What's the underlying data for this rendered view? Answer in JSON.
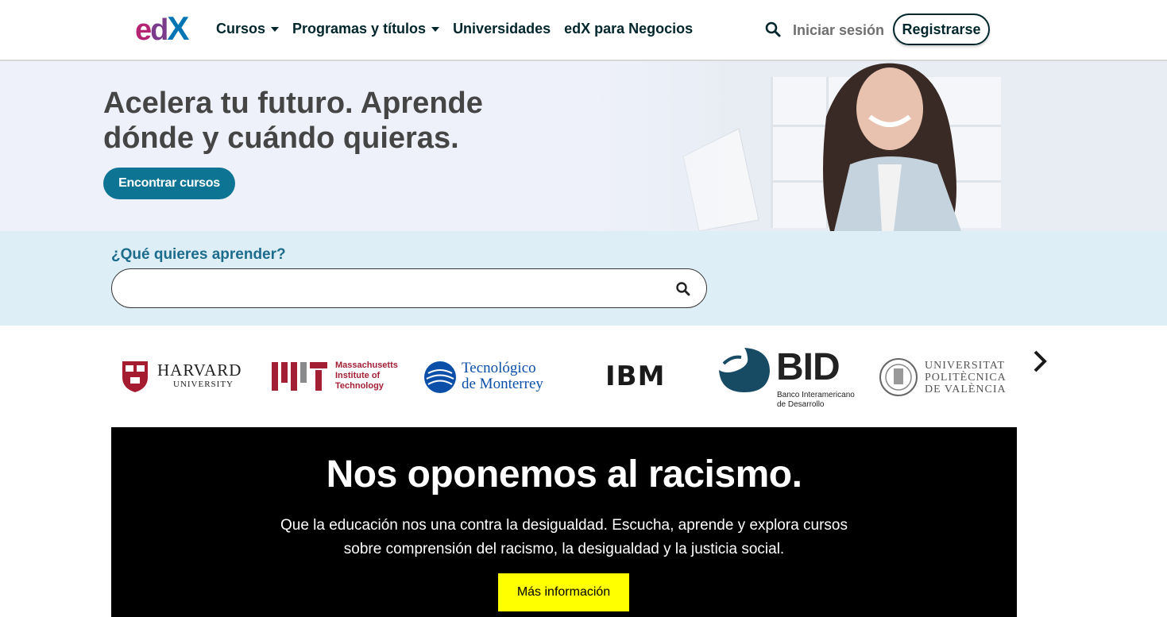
{
  "header": {
    "logo_text": "edX",
    "nav": [
      {
        "label": "Cursos",
        "dropdown": true
      },
      {
        "label": "Programas y títulos",
        "dropdown": true
      },
      {
        "label": "Universidades",
        "dropdown": false
      },
      {
        "label": "edX para Negocios",
        "dropdown": false
      }
    ],
    "signin_label": "Iniciar sesión",
    "register_label": "Registrarse"
  },
  "hero": {
    "title": "Acelera tu futuro. Aprende dónde y cuándo quieras.",
    "cta_label": "Encontrar cursos"
  },
  "search": {
    "label": "¿Qué quieres aprender?",
    "value": "",
    "placeholder": ""
  },
  "partners": {
    "harvard": {
      "name": "HARVARD",
      "sub": "UNIVERSITY"
    },
    "mit": {
      "lines": [
        "Massachusetts",
        "Institute of",
        "Technology"
      ]
    },
    "tec": {
      "lines": [
        "Tecnológico",
        "de Monterrey"
      ]
    },
    "ibm": {
      "name": "IBM"
    },
    "bid": {
      "name": "BID",
      "lines": [
        "Banco Interamericano",
        "de Desarrollo"
      ]
    },
    "upv": {
      "lines": [
        "UNIVERSITAT",
        "POLITÈCNICA",
        "DE VALÈNCIA"
      ]
    }
  },
  "banner": {
    "title": "Nos oponemos al racismo.",
    "text": "Que la educación nos una contra la desigualdad. Escucha, aprende y explora cursos sobre comprensión del racismo, la desigualdad y la justicia social.",
    "button_label": "Más información"
  },
  "colors": {
    "brand_dark": "#00262b",
    "cta_blue": "#0e7494",
    "search_band": "#deeef6",
    "banner_button": "#ffff00"
  }
}
